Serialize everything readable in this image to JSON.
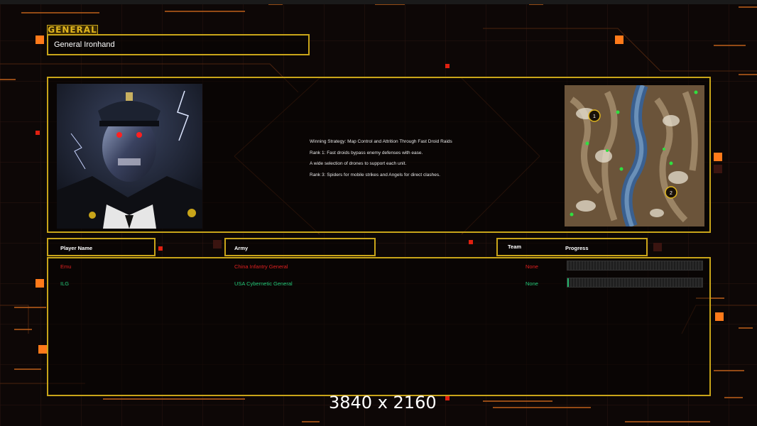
{
  "window": {
    "top_left_label": "",
    "top_right_label": ""
  },
  "general": {
    "tab_label": "GENERAL",
    "name": "General Ironhand"
  },
  "strategy": {
    "lines": [
      "Winning Strategy: Map Control and Attrition Through Fast Droid Raids",
      "Rank 1: Fast droids bypass enemy defenses with ease.",
      "A wide selection of drones to support each unit.",
      "Rank 3: Spiders for mobile strikes and Angels for direct clashes."
    ]
  },
  "portrait": {
    "icon": "cyborg-general-portrait"
  },
  "minimap": {
    "icon": "map-preview",
    "start_positions": [
      "1",
      "2"
    ]
  },
  "columns": {
    "player_name": "Player Name",
    "army": "Army",
    "team": "Team",
    "progress": "Progress"
  },
  "players": [
    {
      "name": "Emu",
      "army": "China Infantry General",
      "team": "None",
      "progress": 0.0,
      "color": "#e02020"
    },
    {
      "name": "ILG",
      "army": "USA Cybernetic General",
      "team": "None",
      "progress": 0.01,
      "color": "#23c878"
    }
  ],
  "watermark": "3840 x 2160",
  "colors": {
    "accent": "#c8a419",
    "orange": "#ff7a1a",
    "background": "#0d0706"
  }
}
